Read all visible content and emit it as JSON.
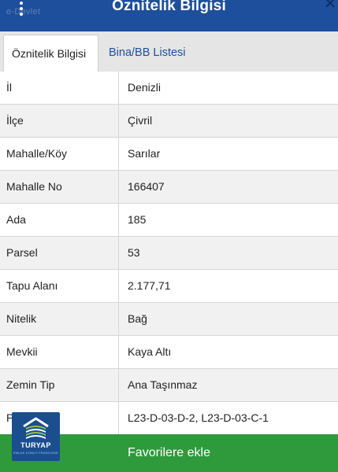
{
  "header": {
    "title": "Öznitelik Bilgisi",
    "close_icon": "✕",
    "faint_label": "e-Devlet"
  },
  "tabs": [
    {
      "label": "Öznitelik Bilgisi",
      "active": true
    },
    {
      "label": "Bina/BB Listesi",
      "active": false
    }
  ],
  "rows": [
    {
      "key": "İl",
      "value": "Denizli"
    },
    {
      "key": "İlçe",
      "value": "Çivril"
    },
    {
      "key": "Mahalle/Köy",
      "value": "Sarılar"
    },
    {
      "key": "Mahalle No",
      "value": "166407"
    },
    {
      "key": "Ada",
      "value": "185"
    },
    {
      "key": "Parsel",
      "value": "53"
    },
    {
      "key": "Tapu Alanı",
      "value": "2.177,71"
    },
    {
      "key": "Nitelik",
      "value": "Bağ"
    },
    {
      "key": "Mevkii",
      "value": "Kaya Altı"
    },
    {
      "key": "Zemin Tip",
      "value": "Ana Taşınmaz"
    },
    {
      "key": "Pafta",
      "value": "L23-D-03-D-2, L23-D-03-C-1"
    }
  ],
  "footer": {
    "button_label": "Favorilere ekle"
  },
  "watermark_logo": {
    "brand": "TURYAP",
    "subtitle": "EMLAK KONUT FRANCHISE",
    "icon": "turyap-house-logo"
  },
  "colors": {
    "header_bg": "#1d4f9c",
    "footer_bg": "#2e9a3c",
    "tab_link": "#1d4f9c"
  }
}
